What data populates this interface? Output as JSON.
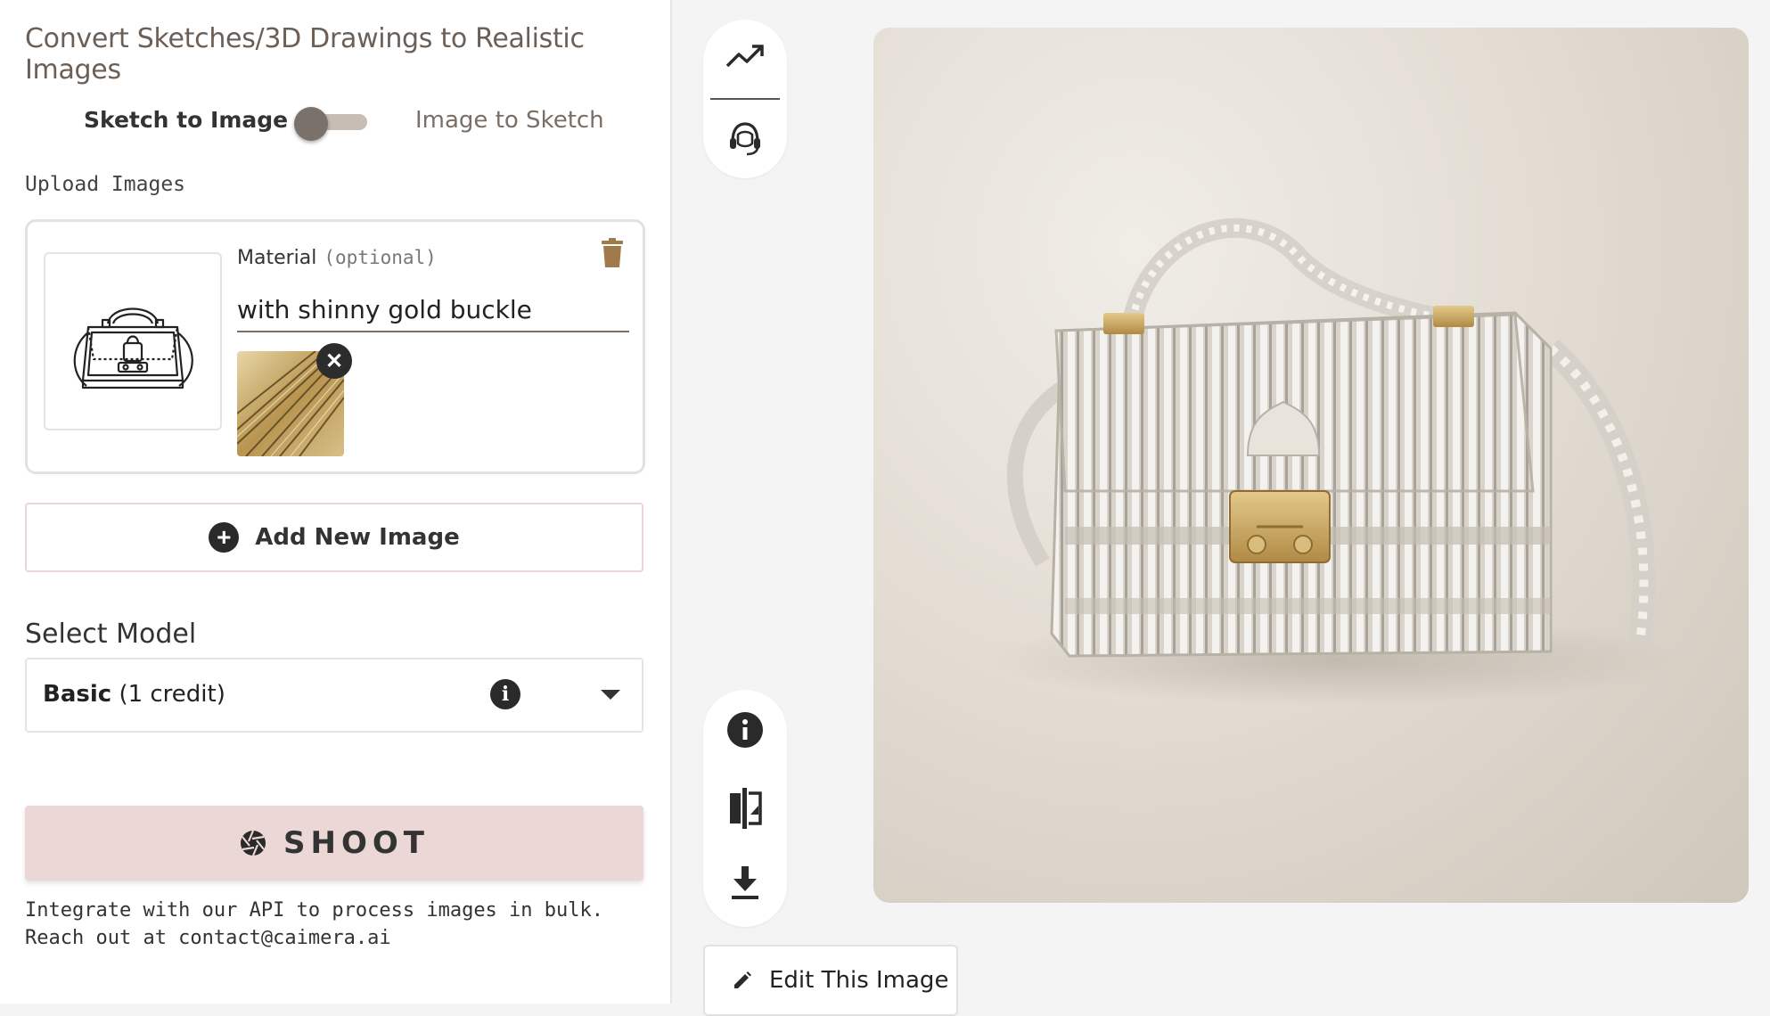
{
  "header": {
    "title": "Convert Sketches/3D Drawings to Realistic Images"
  },
  "mode_toggle": {
    "left_label": "Sketch to Image",
    "right_label": "Image to Sketch",
    "active": "Sketch to Image"
  },
  "upload": {
    "label": "Upload Images",
    "card": {
      "material_label": "Material",
      "material_optional": "(optional)",
      "material_value": "with shinny gold buckle"
    },
    "add_button_label": "Add New Image"
  },
  "model": {
    "label": "Select Model",
    "selected_name": "Basic",
    "selected_cost": "(1 credit)"
  },
  "shoot_button_label": "SHOOT",
  "api_note": {
    "line1": "Integrate with our API to process images in bulk.",
    "line2": "Reach out at contact@caimera.ai"
  },
  "toolbar": {
    "top_icons": [
      "trending-up-icon",
      "support-agent-icon"
    ],
    "bottom_icons": [
      "info-icon",
      "compare-icon",
      "download-icon"
    ]
  },
  "edit_button_label": "Edit This Image",
  "colors": {
    "accent": "#ebd7d5",
    "brand_brown": "#a07a4a",
    "text_muted": "#7a6e65"
  }
}
